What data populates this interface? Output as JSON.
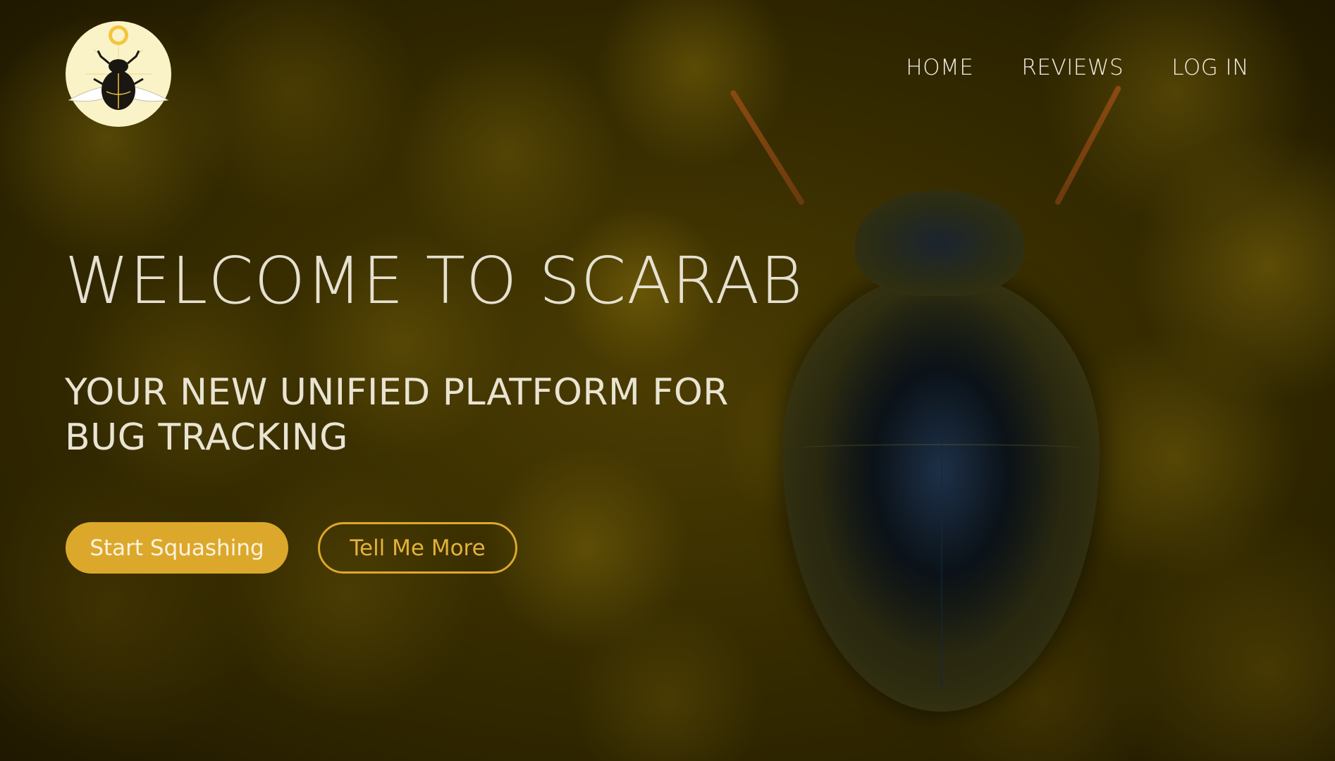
{
  "brand": {
    "logo_icon": "scarab-logo-icon",
    "colors": {
      "accent": "#dca82c",
      "text_light": "#efeadb",
      "logo_bg": "#fbf3c8"
    }
  },
  "nav": {
    "items": [
      {
        "label": "HOME"
      },
      {
        "label": "REVIEWS"
      },
      {
        "label": "LOG IN"
      }
    ]
  },
  "hero": {
    "title": "WELCOME TO SCARAB",
    "subtitle": "YOUR NEW UNIFIED PLATFORM FOR BUG TRACKING"
  },
  "actions": {
    "primary_label": "Start Squashing",
    "secondary_label": "Tell Me More"
  }
}
